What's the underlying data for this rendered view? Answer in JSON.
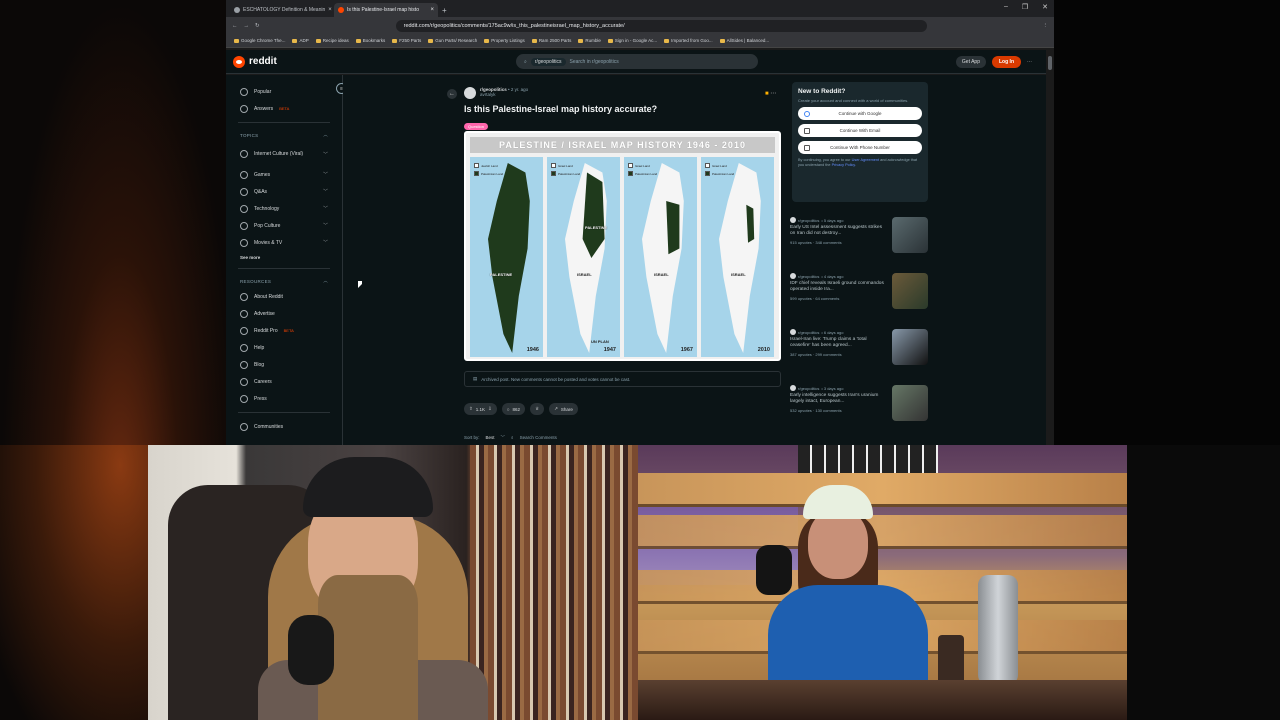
{
  "browser": {
    "tabs": [
      {
        "label": "ESCHATOLOGY Definition & Meanin",
        "active": false
      },
      {
        "label": "Is this Palestine-Israel map histo",
        "active": true
      }
    ],
    "new_tab": "+",
    "url": "reddit.com/r/geopolitics/comments/175ac9w/is_this_palestineisrael_map_history_accurate/",
    "bookmarks": [
      "Google Chrome The...",
      "ADP",
      "Recipe ideas",
      "Bookmarks",
      "F250 Parts",
      "Gun Parts/ Research",
      "Property Listings",
      "Ram 2500 Parts",
      "Rumble",
      "Sign in - Google Ac...",
      "Imported from Goo...",
      "AllSides | Balanced..."
    ]
  },
  "header": {
    "logo_text": "reddit",
    "search_chip": "r/geopolitics",
    "search_placeholder": "Search in r/geopolitics",
    "get_app": "Get App",
    "login": "Log In"
  },
  "sidebar": {
    "top_items": [
      {
        "label": "Popular",
        "badge": ""
      },
      {
        "label": "Answers",
        "badge": "BETA"
      }
    ],
    "topics_header": "TOPICS",
    "topics": [
      "Internet Culture (Viral)",
      "Games",
      "Q&As",
      "Technology",
      "Pop Culture",
      "Movies & TV"
    ],
    "see_more": "See more",
    "resources_header": "RESOURCES",
    "resources": [
      {
        "label": "About Reddit",
        "badge": ""
      },
      {
        "label": "Advertise",
        "badge": ""
      },
      {
        "label": "Reddit Pro",
        "badge": "BETA"
      },
      {
        "label": "Help",
        "badge": ""
      },
      {
        "label": "Blog",
        "badge": ""
      },
      {
        "label": "Careers",
        "badge": ""
      },
      {
        "label": "Press",
        "badge": ""
      }
    ],
    "communities": "Communities"
  },
  "post": {
    "subreddit": "r/geopolitics",
    "age": "• 2 yr. ago",
    "author": "avrtalyk",
    "title": "Is this Palestine-Israel map history accurate?",
    "flair": "Question",
    "image": {
      "title": "PALESTINE / ISRAEL MAP HISTORY 1946 - 2010",
      "panels": [
        {
          "legend_a": "Jewish Land",
          "legend_b": "Palestinian Land",
          "label_a": "PALESTINE",
          "label_b": "",
          "year": "1946",
          "note": ""
        },
        {
          "legend_a": "Israel Land",
          "legend_b": "Palestinian Land",
          "label_a": "PALESTINE",
          "label_b": "ISRAEL",
          "year": "1947",
          "note": "UN PLAN"
        },
        {
          "legend_a": "Israel Land",
          "legend_b": "Palestinian Land",
          "label_a": "",
          "label_b": "ISRAEL",
          "year": "1967",
          "note": ""
        },
        {
          "legend_a": "Israel Land",
          "legend_b": "Palestinian Land",
          "label_a": "",
          "label_b": "ISRAEL",
          "year": "2010",
          "note": ""
        }
      ]
    },
    "archived_notice": "Archived post. New comments cannot be posted and votes cannot be cast.",
    "votes": "1.1K",
    "comments": "862",
    "share": "Share",
    "sort_label": "Sort by:",
    "sort_value": "Best",
    "search_comments": "Search Comments"
  },
  "new_to_reddit": {
    "title": "New to Reddit?",
    "desc": "Create your account and connect with a world of communities.",
    "google": "Continue with Google",
    "email": "Continue With Email",
    "phone": "Continue With Phone Number",
    "terms_prefix": "By continuing, you agree to our",
    "user_agreement": "User Agreement",
    "terms_mid": "and acknowledge that you understand the",
    "privacy": "Privacy Policy."
  },
  "related": [
    {
      "sub": "r/geopolitics",
      "age": "• 5 days ago",
      "title": "Early US Intel assessment suggests strikes on Iran did not destroy...",
      "upvotes": "915 upvotes",
      "comments": "348 comments"
    },
    {
      "sub": "r/geopolitics",
      "age": "• 4 days ago",
      "title": "IDF chief reveals Israeli ground commandos operated inside Ira...",
      "upvotes": "599 upvotes",
      "comments": "64 comments"
    },
    {
      "sub": "r/geopolitics",
      "age": "• 6 days ago",
      "title": "Israel-Iran live: Trump claims a 'total ceasefire' has been agreed...",
      "upvotes": "387 upvotes",
      "comments": "299 comments"
    },
    {
      "sub": "r/geopolitics",
      "age": "• 3 days ago",
      "title": "Early intelligence suggests Iran's uranium largely intact, European...",
      "upvotes": "532 upvotes",
      "comments": "130 comments"
    }
  ]
}
